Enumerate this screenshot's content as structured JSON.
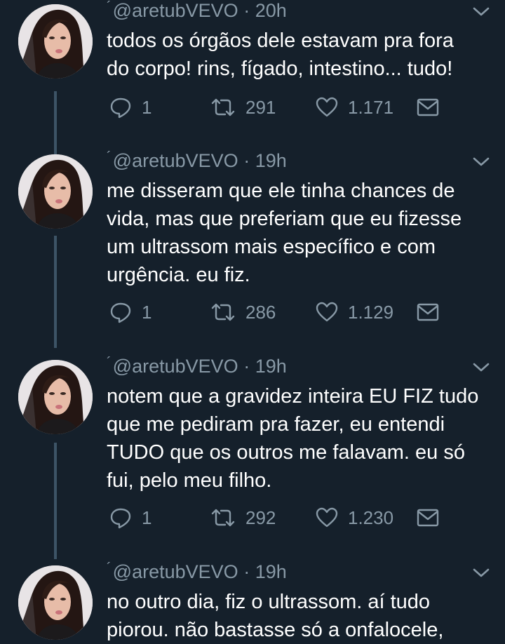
{
  "colors": {
    "background": "#15202b",
    "text": "#ffffff",
    "muted": "#8899a6",
    "thread_line": "#3d5466"
  },
  "tweets": [
    {
      "footnote_mark": "´",
      "handle": "@aretubVEVO",
      "separator": "·",
      "time": "20h",
      "text": "todos os órgãos dele estavam pra fora\ndo corpo! rins, fígado, intestino... tudo!",
      "replies": "1",
      "retweets": "291",
      "likes": "1.171"
    },
    {
      "footnote_mark": "´",
      "handle": "@aretubVEVO",
      "separator": "·",
      "time": "19h",
      "text": "me disseram que ele tinha chances de\nvida, mas que preferiam que eu fizesse\num ultrassom mais específico e com\nurgência. eu fiz.",
      "replies": "1",
      "retweets": "286",
      "likes": "1.129"
    },
    {
      "footnote_mark": "´",
      "handle": "@aretubVEVO",
      "separator": "·",
      "time": "19h",
      "text": "notem que a gravidez inteira EU FIZ tudo\nque me pediram pra fazer, eu entendi\nTUDO que os outros me falavam. eu só\nfui, pelo meu filho.",
      "replies": "1",
      "retweets": "292",
      "likes": "1.230"
    },
    {
      "footnote_mark": "´",
      "handle": "@aretubVEVO",
      "separator": "·",
      "time": "19h",
      "text": "no outro dia, fiz o ultrassom. aí tudo\npiorou. não bastasse só a onfalocele,",
      "replies": "",
      "retweets": "",
      "likes": ""
    }
  ]
}
